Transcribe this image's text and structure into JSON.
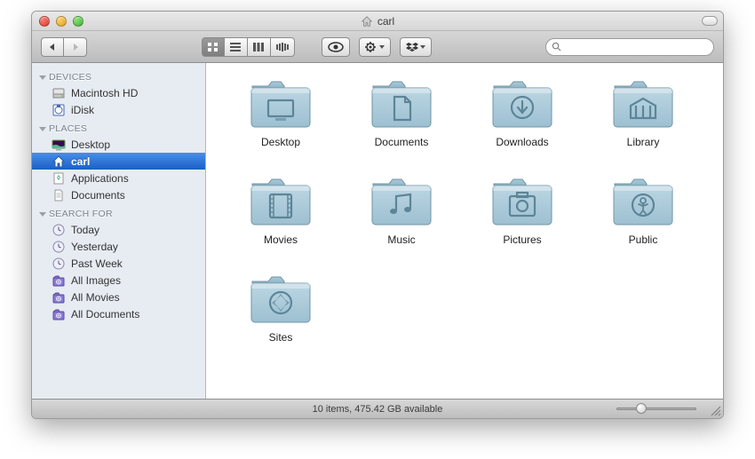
{
  "window": {
    "title": "carl"
  },
  "sidebar": {
    "groups": [
      {
        "label": "DEVICES",
        "items": [
          {
            "label": "Macintosh HD",
            "icon": "hdd"
          },
          {
            "label": "iDisk",
            "icon": "idisk"
          }
        ]
      },
      {
        "label": "PLACES",
        "items": [
          {
            "label": "Desktop",
            "icon": "desktop"
          },
          {
            "label": "carl",
            "icon": "home",
            "selected": true
          },
          {
            "label": "Applications",
            "icon": "app"
          },
          {
            "label": "Documents",
            "icon": "doc"
          }
        ]
      },
      {
        "label": "SEARCH FOR",
        "items": [
          {
            "label": "Today",
            "icon": "clock"
          },
          {
            "label": "Yesterday",
            "icon": "clock"
          },
          {
            "label": "Past Week",
            "icon": "clock"
          },
          {
            "label": "All Images",
            "icon": "smart"
          },
          {
            "label": "All Movies",
            "icon": "smart"
          },
          {
            "label": "All Documents",
            "icon": "smart"
          }
        ]
      }
    ]
  },
  "folders": [
    {
      "label": "Desktop",
      "glyph": "desktop"
    },
    {
      "label": "Documents",
      "glyph": "documents"
    },
    {
      "label": "Downloads",
      "glyph": "downloads"
    },
    {
      "label": "Library",
      "glyph": "library"
    },
    {
      "label": "Movies",
      "glyph": "movies"
    },
    {
      "label": "Music",
      "glyph": "music"
    },
    {
      "label": "Pictures",
      "glyph": "pictures"
    },
    {
      "label": "Public",
      "glyph": "public"
    },
    {
      "label": "Sites",
      "glyph": "sites"
    }
  ],
  "status": {
    "text": "10 items, 475.42 GB available"
  },
  "search": {
    "placeholder": ""
  }
}
